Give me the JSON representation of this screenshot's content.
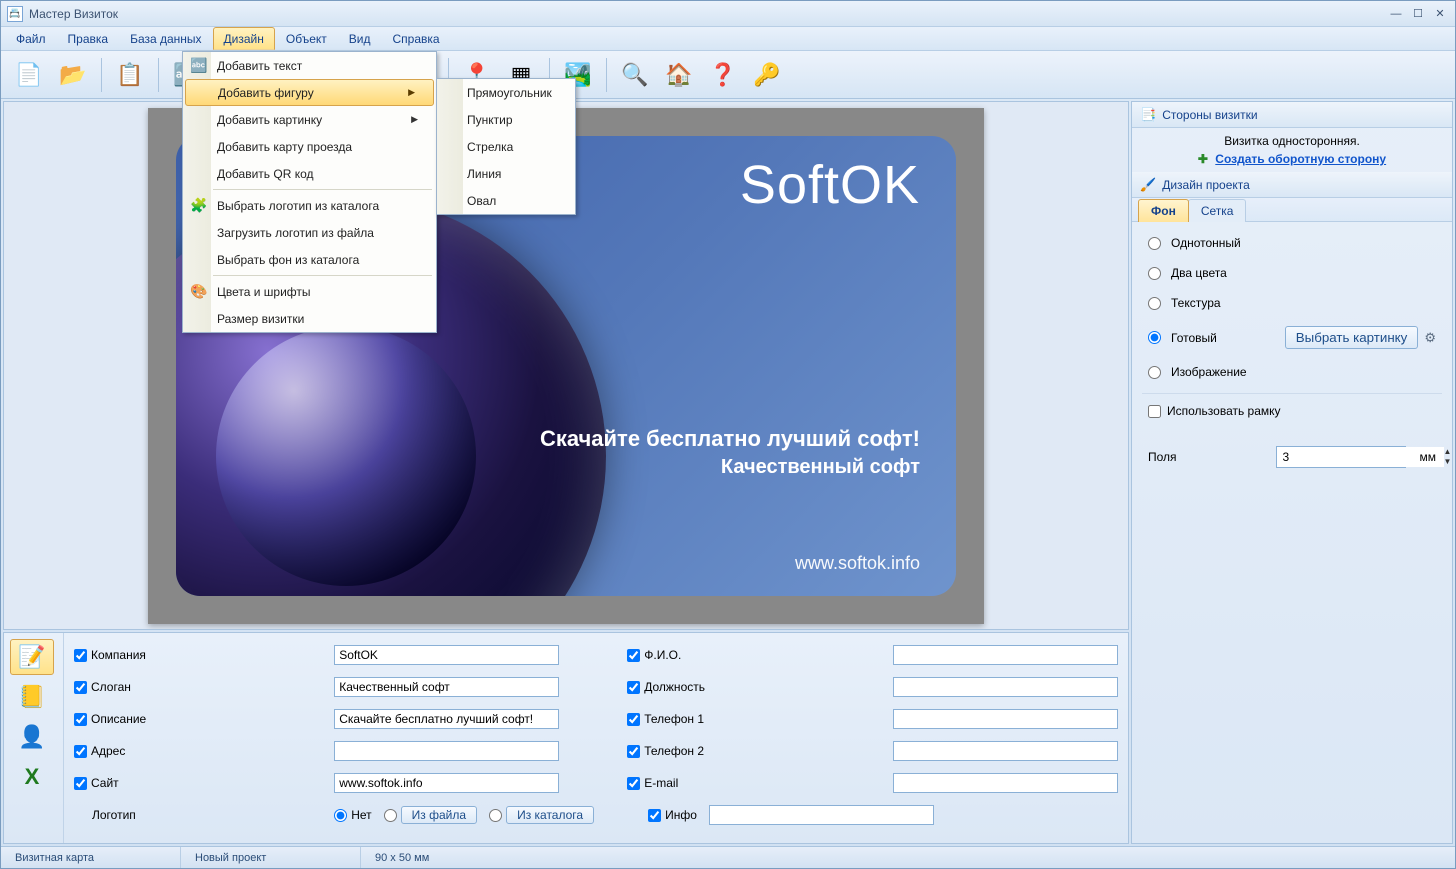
{
  "title": "Мастер Визиток",
  "menus": [
    "Файл",
    "Правка",
    "База данных",
    "Дизайн",
    "Объект",
    "Вид",
    "Справка"
  ],
  "active_menu_index": 3,
  "design_menu": {
    "items": [
      {
        "label": "Добавить текст",
        "icon": "🔤"
      },
      {
        "label": "Добавить фигуру",
        "submenu": true,
        "hover": true
      },
      {
        "label": "Добавить картинку",
        "submenu": true
      },
      {
        "label": "Добавить карту проезда"
      },
      {
        "label": "Добавить QR код"
      },
      {
        "sep": true
      },
      {
        "label": "Выбрать логотип из каталога",
        "icon": "🧩"
      },
      {
        "label": "Загрузить логотип из файла"
      },
      {
        "label": "Выбрать фон из каталога"
      },
      {
        "sep": true
      },
      {
        "label": "Цвета и шрифты",
        "icon": "🎨"
      },
      {
        "label": "Размер визитки"
      }
    ]
  },
  "shape_submenu": [
    "Прямоугольник",
    "Пунктир",
    "Стрелка",
    "Линия",
    "Овал"
  ],
  "card": {
    "brand": "SoftOK",
    "desc": "Скачайте бесплатно лучший софт!",
    "slogan": "Качественный софт",
    "site": "www.softok.info"
  },
  "side": {
    "sides_header": "Стороны визитки",
    "one_sided": "Визитка односторонняя.",
    "create_back": "Создать оборотную сторону",
    "design_header": "Дизайн проекта",
    "tabs": [
      "Фон",
      "Сетка"
    ],
    "bg_options": {
      "solid": "Однотонный",
      "two_colors": "Два цвета",
      "texture": "Текстура",
      "ready": "Готовый",
      "image": "Изображение",
      "select_image_btn": "Выбрать картинку",
      "use_frame": "Использовать рамку",
      "margins_label": "Поля",
      "margins_value": "3",
      "margins_unit": "мм"
    }
  },
  "fields": {
    "company": {
      "label": "Компания",
      "value": "SoftOK",
      "checked": true
    },
    "slogan": {
      "label": "Слоган",
      "value": "Качественный софт",
      "checked": true
    },
    "desc": {
      "label": "Описание",
      "value": "Скачайте бесплатно лучший софт!",
      "checked": true
    },
    "address": {
      "label": "Адрес",
      "value": "",
      "checked": true
    },
    "site": {
      "label": "Сайт",
      "value": "www.softok.info",
      "checked": true
    },
    "logo_label": "Логотип",
    "logo_options": {
      "none": "Нет",
      "from_file": "Из файла",
      "from_catalog": "Из каталога"
    },
    "fio": {
      "label": "Ф.И.О.",
      "value": "",
      "checked": true
    },
    "position": {
      "label": "Должность",
      "value": "",
      "checked": true
    },
    "phone1": {
      "label": "Телефон 1",
      "value": "",
      "checked": true
    },
    "phone2": {
      "label": "Телефон 2",
      "value": "",
      "checked": true
    },
    "email": {
      "label": "E-mail",
      "value": "",
      "checked": true
    },
    "info": {
      "label": "Инфо",
      "value": "",
      "checked": true
    }
  },
  "status": {
    "card_type": "Визитная карта",
    "project": "Новый проект",
    "size": "90 x 50 мм"
  }
}
